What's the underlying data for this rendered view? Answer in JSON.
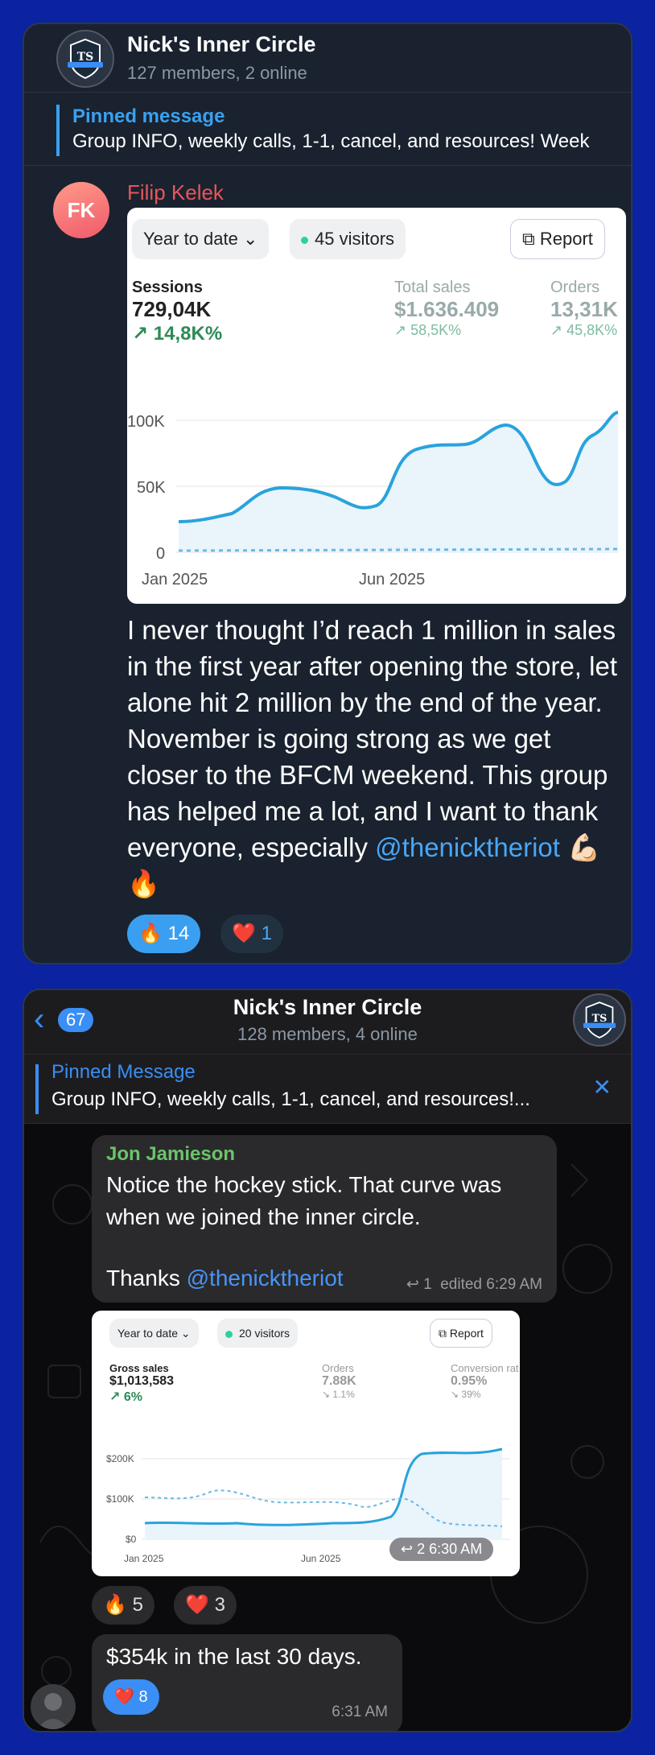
{
  "chat1": {
    "title": "Nick's Inner Circle",
    "members": "127 members, 2 online",
    "pinned_label": "Pinned message",
    "pinned_text": "Group INFO, weekly calls, 1-1, cancel, and resources!   Week",
    "sender_initials": "FK",
    "sender": "Filip Kelek",
    "screenshot": {
      "range_pill": "Year to date",
      "visitors_pill": "45 visitors",
      "report_label": "Report",
      "metric1_label": "Sessions",
      "metric1_value": "729,04K",
      "metric1_change": "14,8K%",
      "metric2_label": "Total sales",
      "metric2_value": "$1.636.409",
      "metric2_change": "58,5K%",
      "metric3_label": "Orders",
      "metric3_value": "13,31K",
      "metric3_change": "45,8K%",
      "ticks": [
        "100K",
        "50K",
        "0"
      ],
      "xticks": [
        "Jan 2025",
        "Jun 2025"
      ]
    },
    "message_before_mention": "I never thought I’d reach 1 million in sales in the first year after opening the store, let alone hit 2 million by the end of the year. November is going strong as we get closer to the BFCM weekend. This group has helped me a lot, and I want to thank everyone, especially ",
    "mention": "@thenicktheriot",
    "message_after_mention": " 💪🏻🔥",
    "reactions": [
      {
        "emoji": "🔥",
        "count": "14"
      },
      {
        "emoji": "❤️",
        "count": "1"
      }
    ]
  },
  "chat2": {
    "back_count": "67",
    "title": "Nick's Inner Circle",
    "members": "128 members, 4 online",
    "pinned_label": "Pinned Message",
    "pinned_text": "Group INFO, weekly calls, 1-1, cancel, and resources!...",
    "close_icon": "✕",
    "msg1": {
      "sender": "Jon Jamieson",
      "text_line1": "Notice the hockey stick. That curve was when we joined the inner circle.",
      "text_thanks": "Thanks ",
      "mention": "@thenicktheriot",
      "replies": "1",
      "meta": "edited 6:29 AM"
    },
    "screenshot": {
      "range_pill": "Year to date",
      "visitors_pill": "20 visitors",
      "report_label": "Report",
      "metric1_label": "Gross sales",
      "metric1_value": "$1,013,583",
      "metric1_change": "6%",
      "metric2_label": "Orders",
      "metric2_value": "7.88K",
      "metric2_change": "1.1%",
      "metric3_label": "Conversion rat",
      "metric3_value": "0.95%",
      "metric3_change": "39%",
      "ticks": [
        "$200K",
        "$100K",
        "$0"
      ],
      "xticks": [
        "Jan 2025",
        "Jun 2025"
      ],
      "overlay_replies": "2",
      "overlay_time": "6:30 AM"
    },
    "reactions": [
      {
        "emoji": "🔥",
        "count": "5"
      },
      {
        "emoji": "❤️",
        "count": "3"
      }
    ],
    "msg2": {
      "text": "$354k in the last 30 days.",
      "reaction_emoji": "❤️",
      "reaction_count": "8",
      "time": "6:31 AM"
    }
  },
  "colors": {
    "accent_blue": "#3a8ef5",
    "sender_red": "#e8555a",
    "sender_green": "#6cc36a",
    "frame": "#0b23a0"
  }
}
